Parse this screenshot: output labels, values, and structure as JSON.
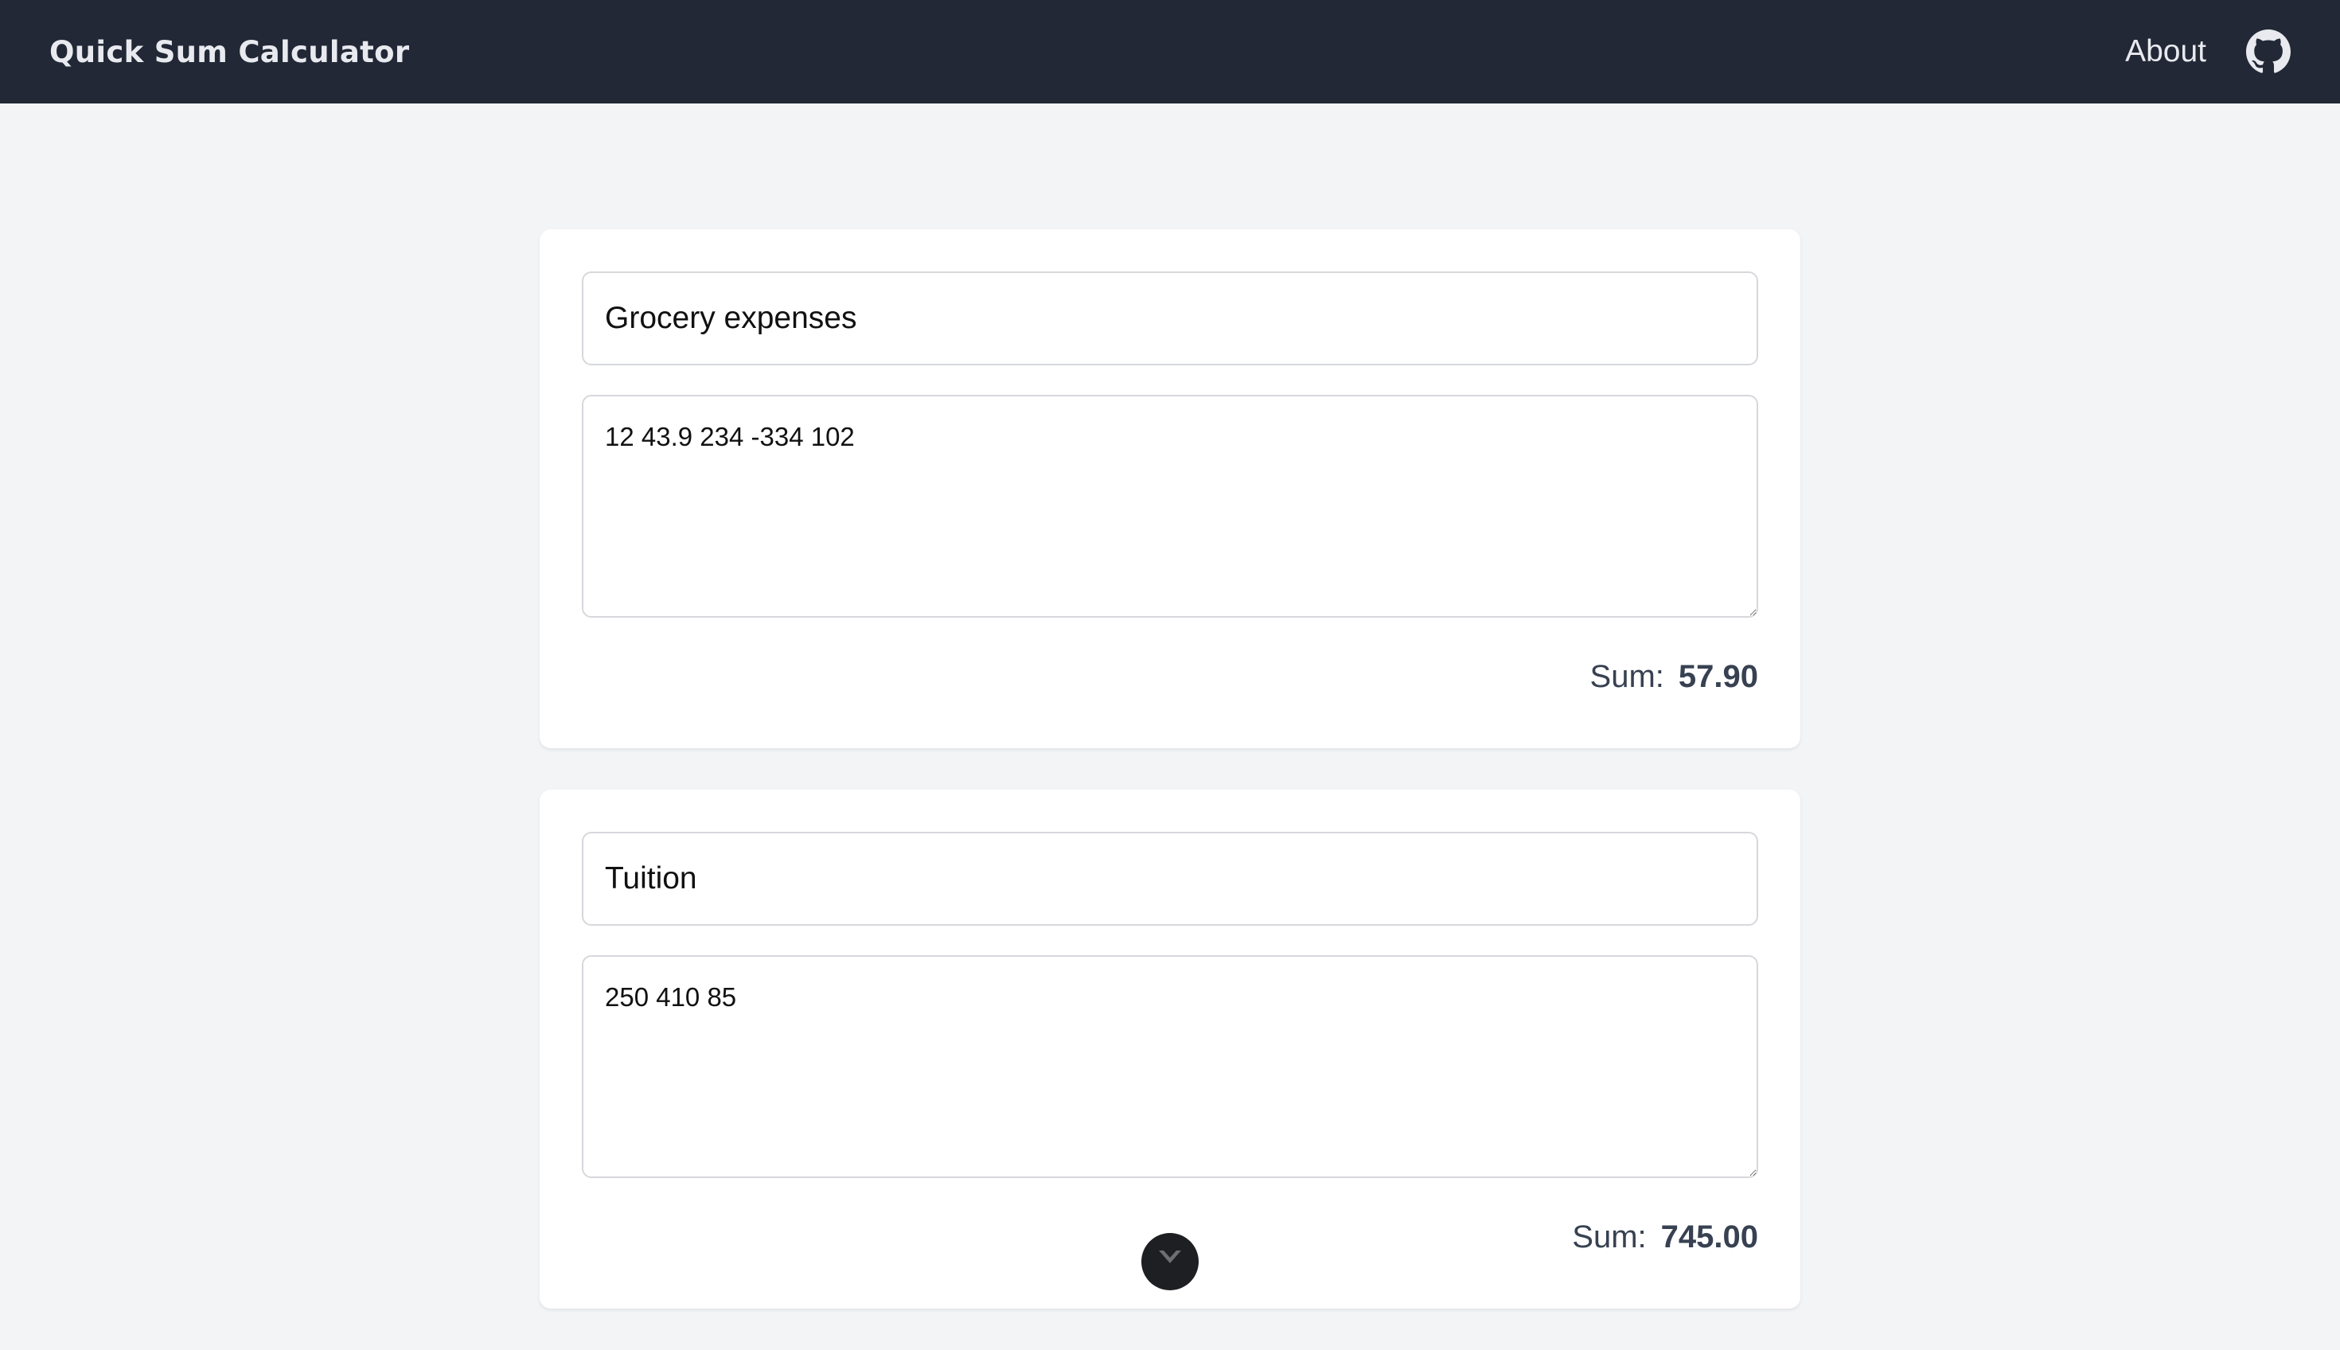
{
  "navbar": {
    "brand": "Quick Sum Calculator",
    "about_label": "About",
    "github_icon": "github-icon"
  },
  "cards": [
    {
      "title": "Grocery expenses",
      "numbers": "12 43.9 234 -334 102",
      "sum_label": "Sum:",
      "sum_value": "57.90"
    },
    {
      "title": "Tuition",
      "numbers": "250 410 85",
      "sum_label": "Sum:",
      "sum_value": "745.00"
    }
  ],
  "scroll_button": {
    "icon": "chevron-down-icon"
  },
  "colors": {
    "navbar_bg": "#222836",
    "page_bg": "#f3f4f6",
    "card_bg": "#ffffff",
    "sum_text": "#374151"
  }
}
